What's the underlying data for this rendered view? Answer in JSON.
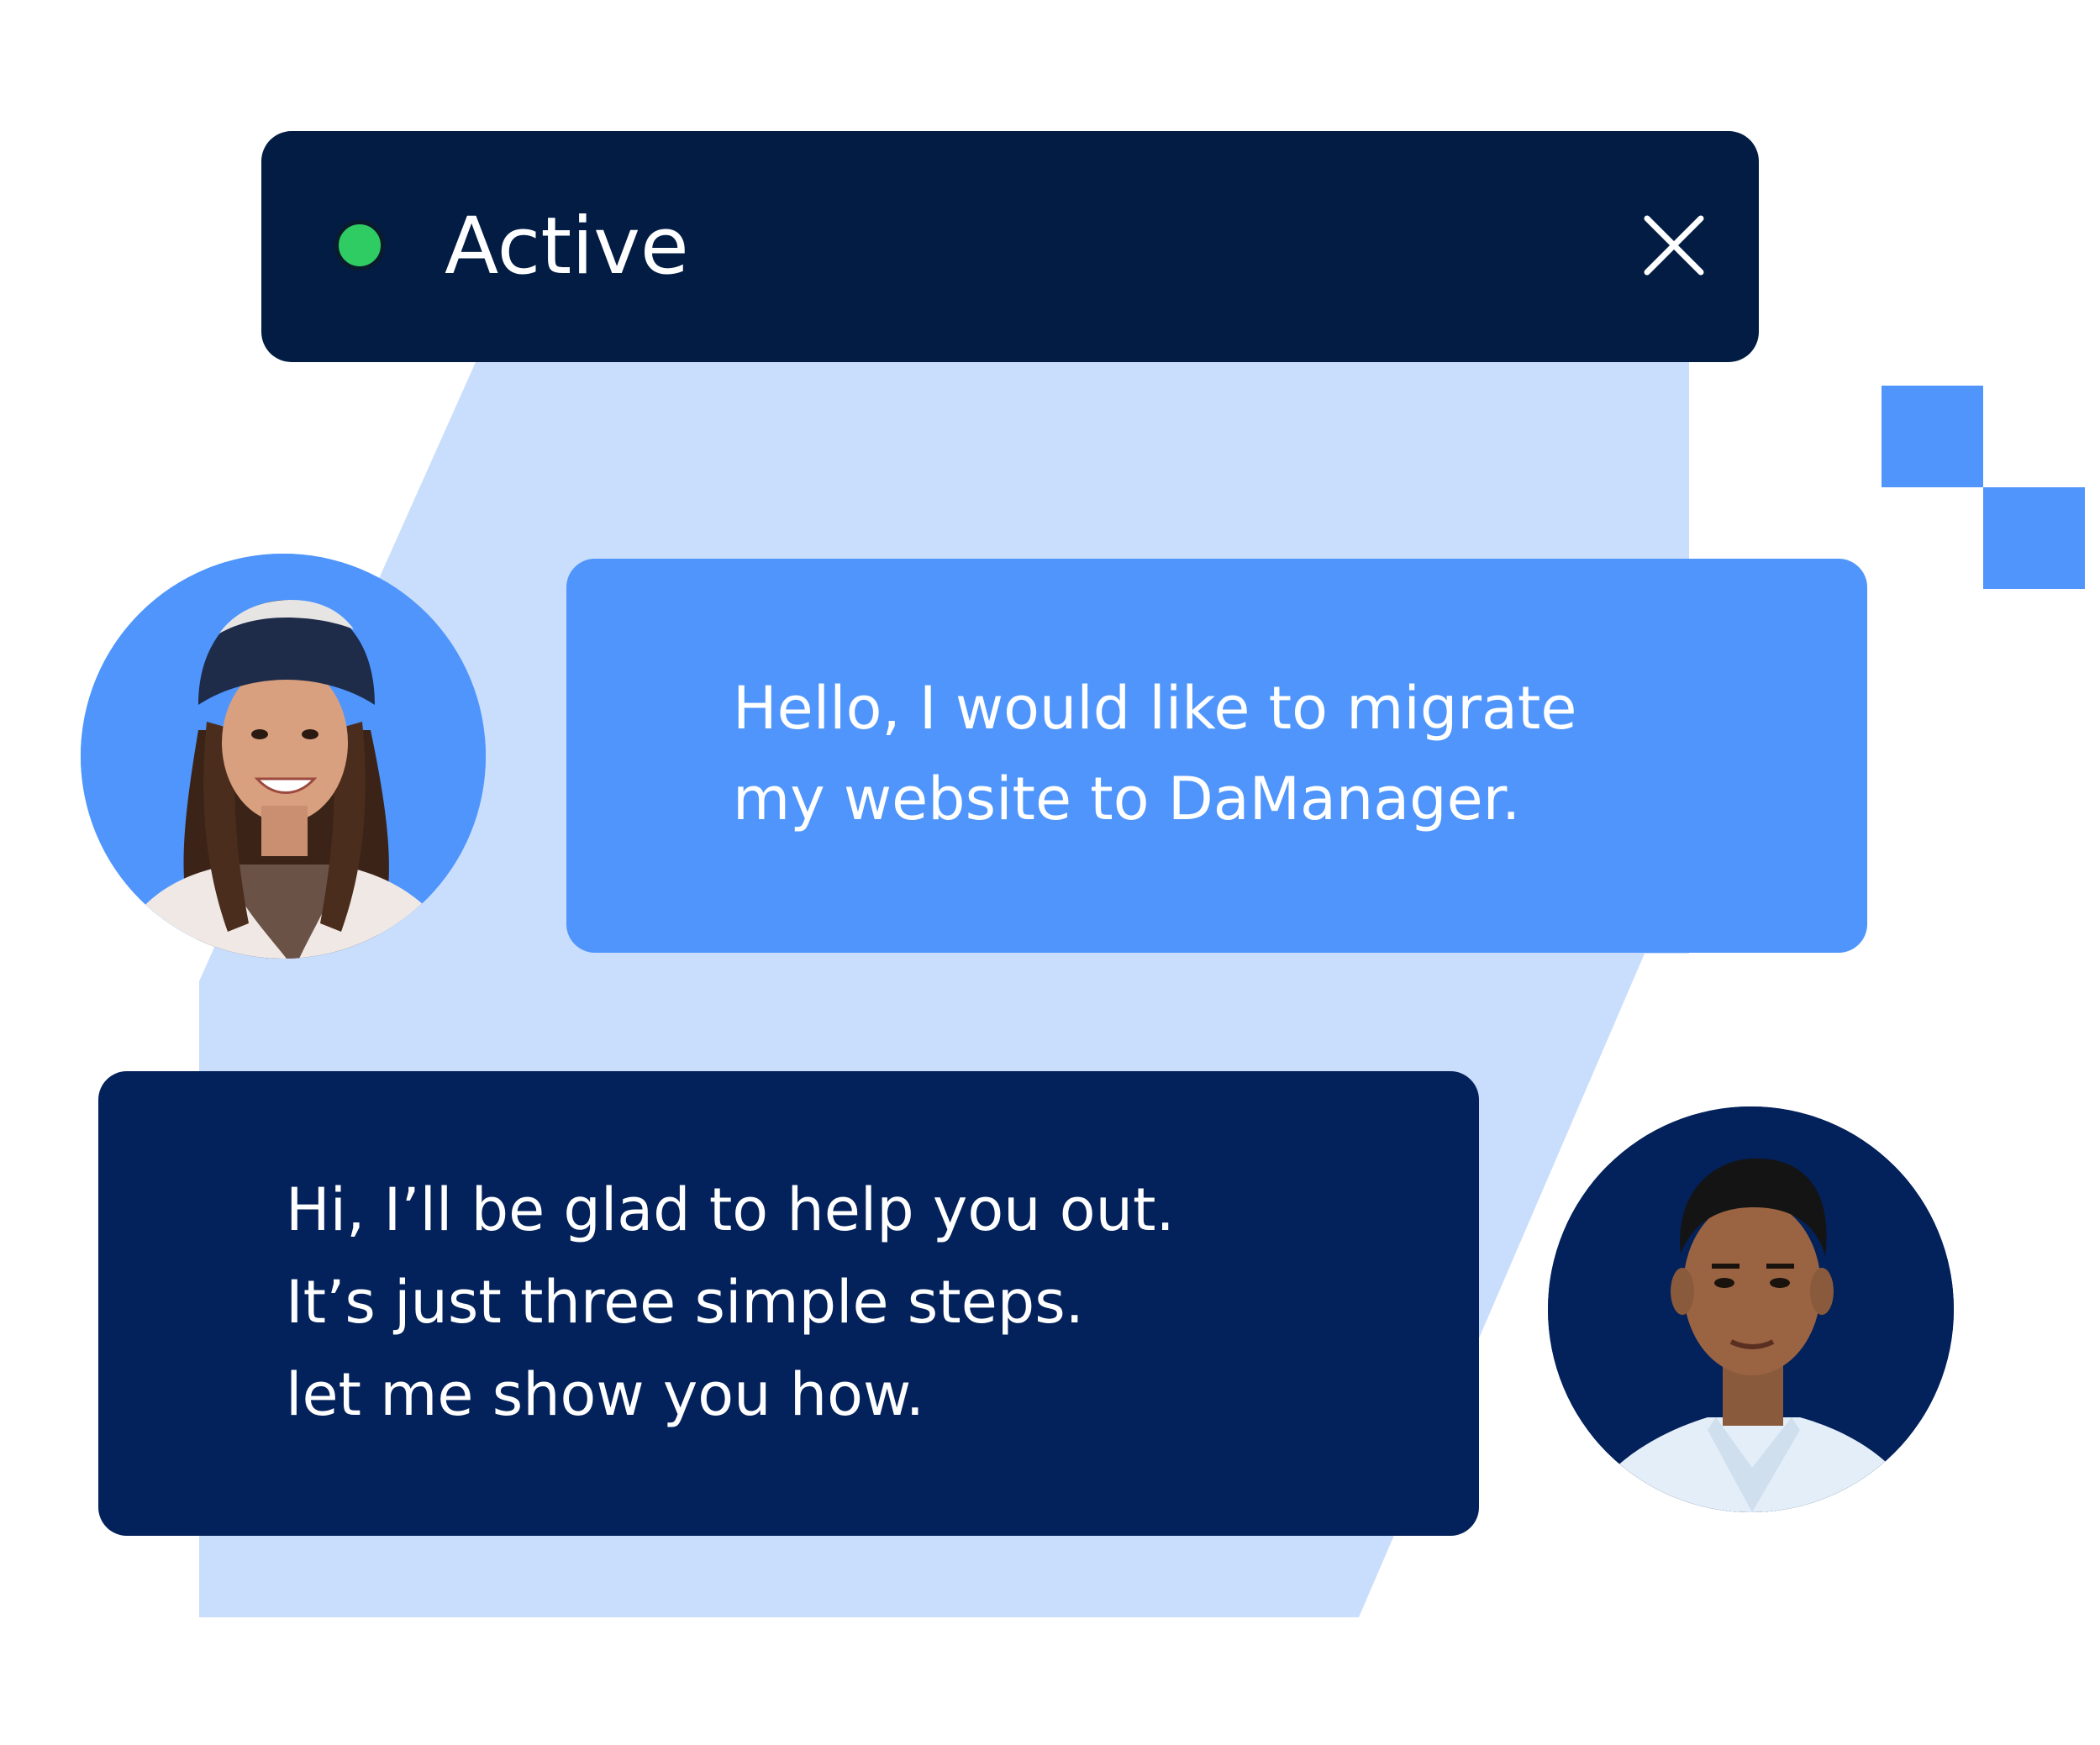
{
  "colors": {
    "background": "#ffffff",
    "backdrop": "#c9ddfc",
    "accent": "#4f95fc",
    "header": "#021c43",
    "agent_bubble": "#03215a",
    "status_active": "#2fcb63",
    "text_on_dark": "#ffffff"
  },
  "header": {
    "status_label": "Active",
    "status_icon": "status-dot-icon",
    "close_icon": "close-icon"
  },
  "conversation": {
    "user_message": {
      "lines": [
        "Hello, I would like to migrate",
        "my website to DaManager."
      ],
      "avatar_icon": "user-avatar"
    },
    "agent_message": {
      "lines": [
        "Hi, I’ll be glad to help you out.",
        "It’s just three simple steps.",
        "let me show you how."
      ],
      "avatar_icon": "agent-avatar"
    }
  }
}
